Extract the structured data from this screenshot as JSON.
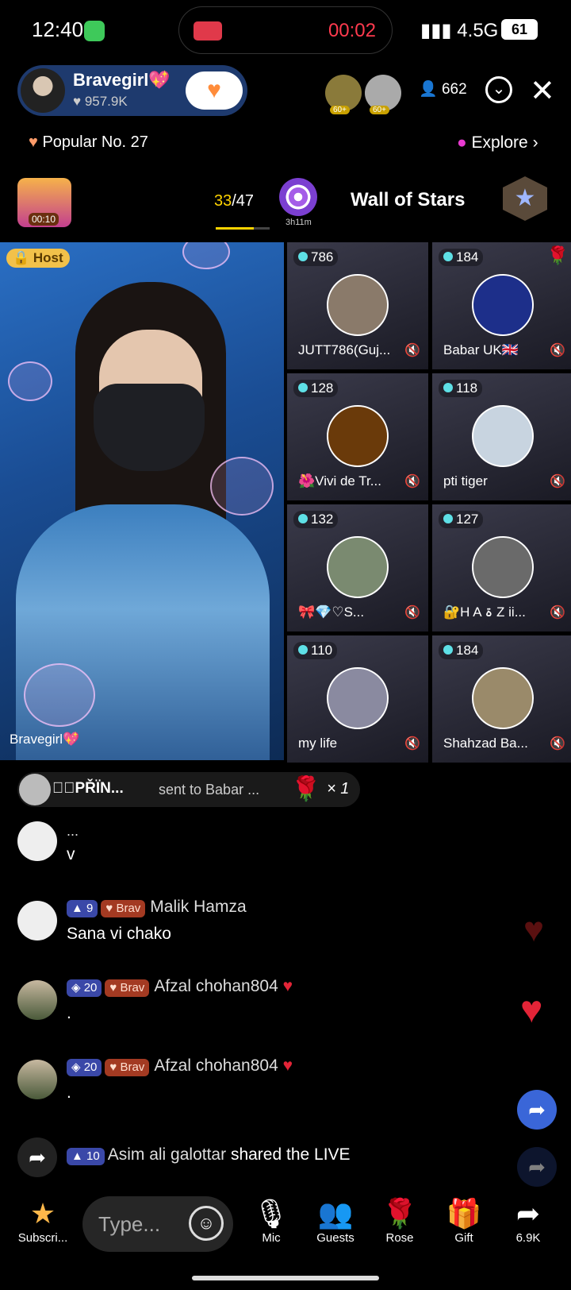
{
  "status": {
    "time": "12:40",
    "record_time": "00:02",
    "network": "4.5G",
    "battery": "61"
  },
  "host": {
    "name": "Bravegirl💖",
    "likes": "♥ 957.9K",
    "viewers": "662",
    "top_badges": [
      "60+",
      "60+"
    ]
  },
  "popular": "Popular No. 27",
  "explore": "Explore",
  "chest_timer": "00:10",
  "progress": {
    "current": "33",
    "total": "/47",
    "fraction": 0.7
  },
  "target_label": "3h11m",
  "wall_title": "Wall of Stars",
  "stage": {
    "host_tag": "Host",
    "host_name": "Bravegirl💖",
    "guests": [
      {
        "count": "786",
        "name": "JUTT786(Guj...",
        "avatar_color": "#8a7a6a"
      },
      {
        "count": "184",
        "name": "Babar UK🇬🇧",
        "avatar_color": "#1d2f8a",
        "rose": true
      },
      {
        "count": "128",
        "name": "🌺Vivi de Tr...",
        "avatar_color": "#6a3a0a"
      },
      {
        "count": "118",
        "name": "pti tiger",
        "avatar_color": "#c8d4e0"
      },
      {
        "count": "132",
        "name": "🎀💎♡S...",
        "avatar_color": "#7a8a70"
      },
      {
        "count": "127",
        "name": "🔐H A ۃ Z ii...",
        "avatar_color": "#6a6a6a"
      },
      {
        "count": "110",
        "name": "my life",
        "avatar_color": "#8a8aa0"
      },
      {
        "count": "184",
        "name": "Shahzad Ba...",
        "avatar_color": "#9a8a6a"
      }
    ]
  },
  "gift_banner": {
    "name": "★ꦿPŘÏN...",
    "text": "sent to Babar ...",
    "count": "× 1"
  },
  "chat": [
    {
      "name": "...",
      "message": "v"
    },
    {
      "level": "9",
      "badge": "Brav",
      "name": "Malik Hamza",
      "message": "Sana vi chako"
    },
    {
      "level": "20",
      "badge": "Brav",
      "name": "Afzal chohan804",
      "message": "."
    },
    {
      "level": "20",
      "badge": "Brav",
      "name": "Afzal chohan804",
      "message": "."
    }
  ],
  "share_line": {
    "level": "10",
    "name": "Asim ali galottar",
    "text": "shared the LIVE"
  },
  "bottom": {
    "subscribe": "Subscri...",
    "type_placeholder": "Type...",
    "mic": "Mic",
    "guests": "Guests",
    "rose": "Rose",
    "gift": "Gift",
    "share_count": "6.9K"
  }
}
